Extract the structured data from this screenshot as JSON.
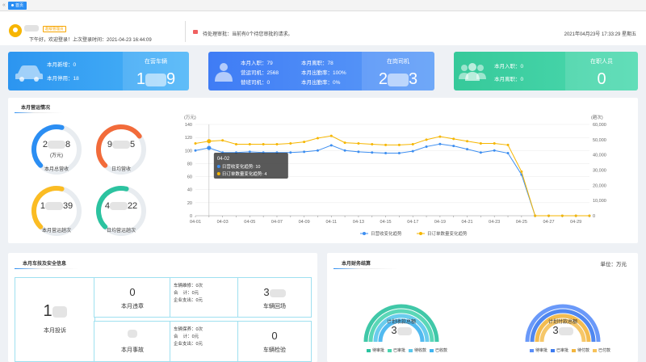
{
  "tabbar": {
    "nav_icon": "«",
    "tab_label": "首页"
  },
  "header": {
    "role_badge": "超级管理员",
    "welcome": "下午好，欢迎登录！上次登录时间：2021-04-23 16:44:09",
    "notice": "待处理审批：当前有0个待您审批的请求。",
    "datetime": "2021年04月23号 17:33:29 星期五"
  },
  "cards": {
    "vehicles": {
      "new_label": "本月新增：0",
      "stop_label": "本月停用：18",
      "title": "在营车辆",
      "value_left": "1",
      "value_right": "9"
    },
    "drivers": {
      "join": "本月入职：79",
      "leave": "本月离职：78",
      "operating": "营运司机：2568",
      "attendance": "本月出勤率：100%",
      "shift": "替班司机：0",
      "attendance2": "本月出勤率：0%",
      "title": "在岗司机",
      "value_left": "2",
      "value_right": "3"
    },
    "staff": {
      "join": "本月入职：0",
      "leave": "本月离职：0",
      "title": "在职人员",
      "value": "0"
    }
  },
  "revenue_panel": {
    "title": "本月营运情况",
    "gauges": [
      {
        "center_top_left": "2",
        "center_top_right": "8",
        "center_unit": "(万元)",
        "label": "本月总营收",
        "color": "#2b8ef3",
        "fraction": 0.55
      },
      {
        "center_top_left": "9",
        "center_top_right": "5",
        "center_unit": "",
        "label": "日均营收",
        "color": "#f26b3a",
        "fraction": 0.7
      },
      {
        "center_top_left": "1",
        "center_top_right": "39",
        "center_unit": "",
        "label": "本月营运趟次",
        "color": "#fbbc23",
        "fraction": 0.55
      },
      {
        "center_top_left": "4",
        "center_top_right": "22",
        "center_unit": "",
        "label": "日均营运趟次",
        "color": "#2cc3a0",
        "fraction": 0.55
      }
    ]
  },
  "chart_data": {
    "type": "line",
    "y_left_label": "(万元)",
    "y_right_label": "(趟次)",
    "y_left_ticks": [
      "0",
      "20",
      "40",
      "60",
      "80",
      "100",
      "120",
      "140"
    ],
    "y_right_ticks": [
      "0",
      "10,000",
      "20,000",
      "30,000",
      "40,000",
      "50,000",
      "60,000"
    ],
    "ylim_left": [
      0,
      140
    ],
    "ylim_right": [
      0,
      60000
    ],
    "categories": [
      "04-01",
      "04-02",
      "04-03",
      "04-04",
      "04-05",
      "04-06",
      "04-07",
      "04-08",
      "04-09",
      "04-10",
      "04-11",
      "04-12",
      "04-13",
      "04-14",
      "04-15",
      "04-16",
      "04-17",
      "04-18",
      "04-19",
      "04-20",
      "04-21",
      "04-22",
      "04-23",
      "04-24",
      "04-25",
      "04-26",
      "04-27",
      "04-28",
      "04-29",
      "04-30"
    ],
    "x_tick_labels": [
      "04-01",
      "04-03",
      "04-05",
      "04-07",
      "04-09",
      "04-11",
      "04-13",
      "04-15",
      "04-17",
      "04-19",
      "04-21",
      "04-23",
      "04-25",
      "04-27",
      "04-29"
    ],
    "series": [
      {
        "name": "日营收变化趋势",
        "axis": "left",
        "color": "#3d8ef0",
        "values": [
          100,
          104,
          97,
          97,
          98,
          97,
          97,
          97,
          98,
          100,
          108,
          100,
          98,
          97,
          96,
          96,
          99,
          106,
          110,
          107,
          102,
          97,
          100,
          96,
          63,
          0,
          0,
          0,
          0,
          0
        ]
      },
      {
        "name": "日订单数量变化趋势",
        "axis": "right",
        "color": "#f6b600",
        "values": [
          47500,
          49000,
          49500,
          47000,
          47000,
          47000,
          47000,
          47500,
          48500,
          51000,
          52500,
          48000,
          47500,
          47000,
          46500,
          46500,
          47000,
          50000,
          52000,
          50500,
          49000,
          47500,
          47500,
          46500,
          29000,
          0,
          0,
          0,
          0,
          0
        ]
      }
    ],
    "tooltip": {
      "title": "04-02",
      "line1": "日营收变化趋势: 10",
      "line2": "日订单数量变化趋势: 4"
    }
  },
  "safety_panel": {
    "title": "本月车技及安全信息",
    "complaints_label": "本月投诉",
    "complaints_value": "1",
    "violations_value": "0",
    "violations_label": "本月违章",
    "accidents_label": "本月事故",
    "repair_rows": "车辆维修：0次\n合    计：0元\n企业支出：0元",
    "insure_rows": "车辆保养：0次\n合    计：0元\n企业支出：0元",
    "return_value": "3",
    "return_label": "车辆回场",
    "inspect_value": "0",
    "inspect_label": "车辆检验"
  },
  "finance_panel": {
    "title": "本月财务结算",
    "unit": "单位：万元",
    "left_center": "计划收款总额",
    "left_value": "3",
    "right_center": "计划付款总额",
    "right_value": "3",
    "left_legend": [
      "待审批",
      "已审批",
      "待收款",
      "已收款"
    ],
    "right_legend": [
      "待审批",
      "已审批",
      "待付款",
      "已付款"
    ],
    "left_colors": [
      "#2cc3a0",
      "#4ad4b0",
      "#5bc8ec",
      "#40b4f0"
    ],
    "right_colors": [
      "#5b8ff9",
      "#3d7bf0",
      "#f3b63e",
      "#f6c25a"
    ]
  }
}
